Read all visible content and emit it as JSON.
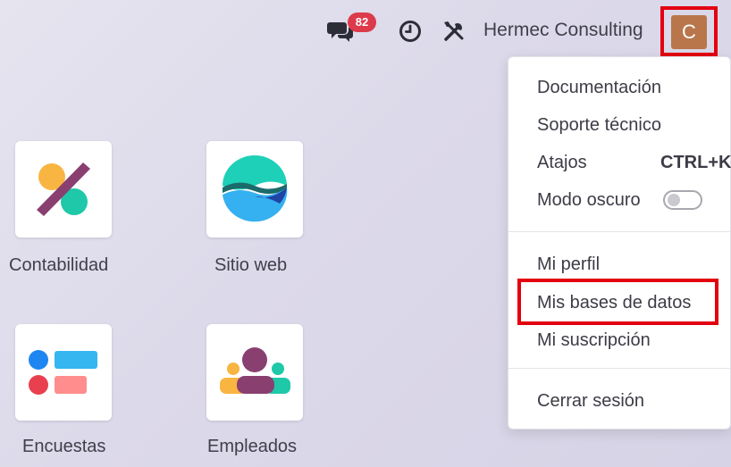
{
  "topbar": {
    "chat_badge": "82",
    "company": "Hermec Consulting",
    "avatar_letter": "C"
  },
  "menu": {
    "documentation": "Documentación",
    "support": "Soporte técnico",
    "shortcuts": "Atajos",
    "shortcuts_key": "CTRL+K",
    "dark_mode": "Modo oscuro",
    "dark_mode_on": false,
    "profile": "Mi perfil",
    "databases": "Mis bases de datos",
    "subscription": "Mi suscripción",
    "logout": "Cerrar sesión"
  },
  "apps": [
    {
      "label": "Contabilidad",
      "icon": "accounting-icon"
    },
    {
      "label": "Sitio web",
      "icon": "website-icon"
    },
    {
      "label": "Encuestas",
      "icon": "surveys-icon"
    },
    {
      "label": "Empleados",
      "icon": "employees-icon"
    }
  ],
  "colors": {
    "highlight": "#e3000f",
    "badge": "#dc3b4b",
    "avatar": "#b8764a"
  }
}
